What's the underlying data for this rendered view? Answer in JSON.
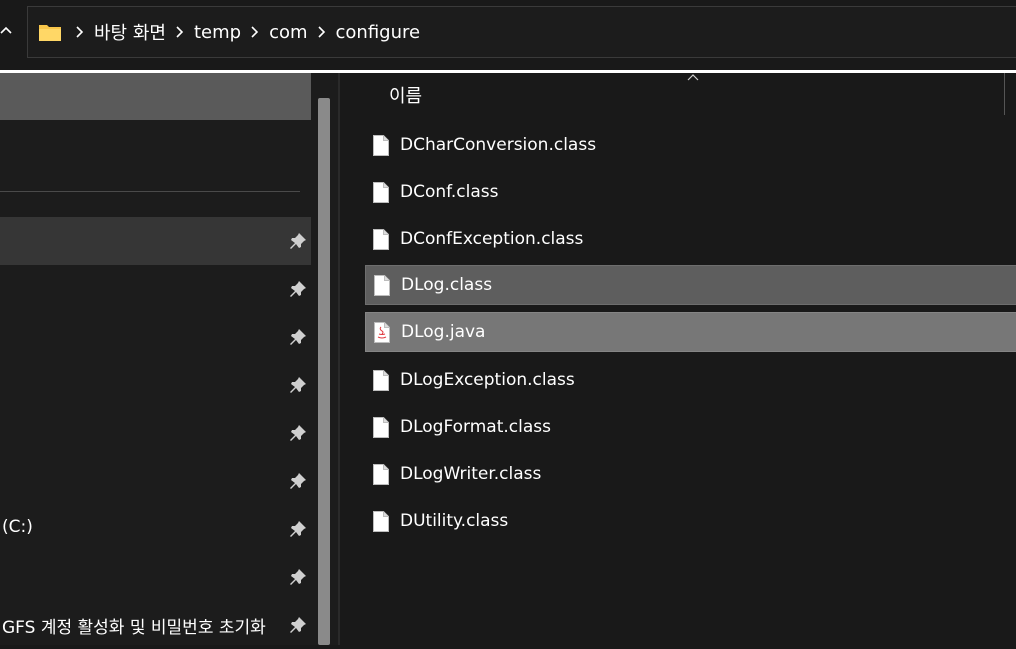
{
  "breadcrumb": {
    "items": [
      "바탕 화면",
      "temp",
      "com",
      "configure"
    ]
  },
  "nav": {
    "items": [
      {
        "label": "",
        "pinned": true
      },
      {
        "label": "",
        "pinned": true
      },
      {
        "label": "",
        "pinned": true
      },
      {
        "label": "",
        "pinned": true
      },
      {
        "label": "",
        "pinned": true
      },
      {
        "label": "",
        "pinned": true
      },
      {
        "label": "(C:)",
        "pinned": true
      },
      {
        "label": "",
        "pinned": true
      },
      {
        "label": "GFS 계정 활성화 및 비밀번호 초기화",
        "pinned": true
      }
    ]
  },
  "file_list": {
    "column_header": "이름",
    "files": [
      {
        "name": "DCharConversion.class",
        "icon": "file-icon"
      },
      {
        "name": "DConf.class",
        "icon": "file-icon"
      },
      {
        "name": "DConfException.class",
        "icon": "file-icon"
      },
      {
        "name": "DLog.class",
        "icon": "file-icon",
        "selected": true
      },
      {
        "name": "DLog.java",
        "icon": "java-file-icon",
        "selected": true
      },
      {
        "name": "DLogException.class",
        "icon": "file-icon"
      },
      {
        "name": "DLogFormat.class",
        "icon": "file-icon"
      },
      {
        "name": "DLogWriter.class",
        "icon": "file-icon"
      },
      {
        "name": "DUtility.class",
        "icon": "file-icon"
      }
    ]
  },
  "colors": {
    "background": "#191919",
    "selection": "#5e5e5e",
    "selection_focus": "#777777",
    "folder": "#f8c64a",
    "accent": "#ff8c00"
  }
}
